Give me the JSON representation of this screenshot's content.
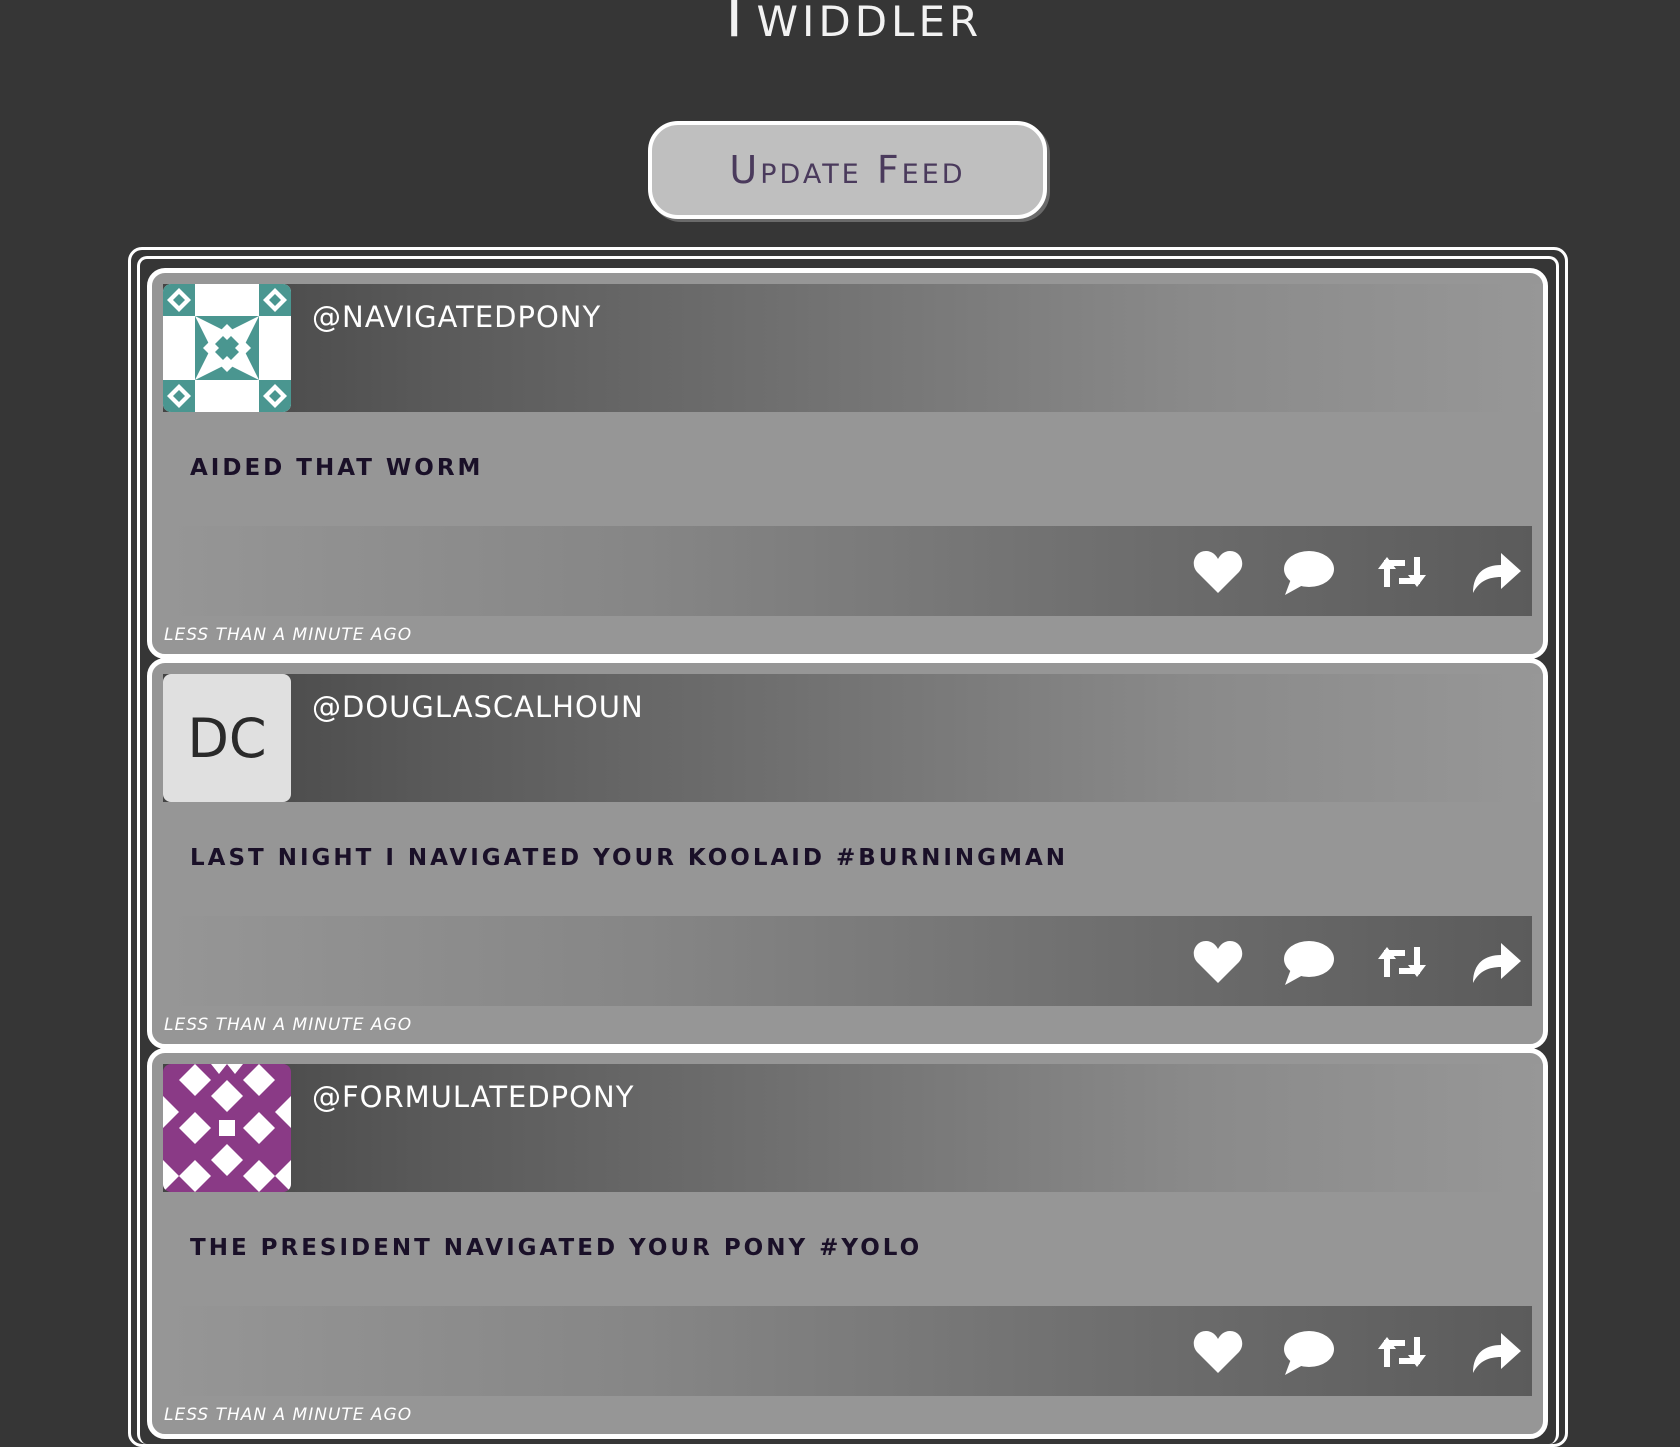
{
  "app": {
    "title": "Twiddler"
  },
  "controls": {
    "update_label": "Update Feed"
  },
  "feed": {
    "tweets": [
      {
        "handle": "@NAVIGATEDPONY",
        "message": "AIDED THAT WORM",
        "timestamp": "LESS THAN A MINUTE AGO",
        "avatar": {
          "type": "identicon",
          "color": "#4a9690"
        }
      },
      {
        "handle": "@DOUGLASCALHOUN",
        "message": "LAST NIGHT I NAVIGATED YOUR KOOLAID #BURNINGMAN",
        "timestamp": "LESS THAN A MINUTE AGO",
        "avatar": {
          "type": "initials",
          "initials": "DC"
        }
      },
      {
        "handle": "@FORMULATEDPONY",
        "message": "THE PRESIDENT NAVIGATED YOUR PONY #YOLO",
        "timestamp": "LESS THAN A MINUTE AGO",
        "avatar": {
          "type": "identicon",
          "color": "#8a3a86"
        }
      }
    ]
  },
  "actions": [
    {
      "icon": "heart-icon"
    },
    {
      "icon": "comment-icon"
    },
    {
      "icon": "retweet-icon"
    },
    {
      "icon": "share-icon"
    }
  ]
}
